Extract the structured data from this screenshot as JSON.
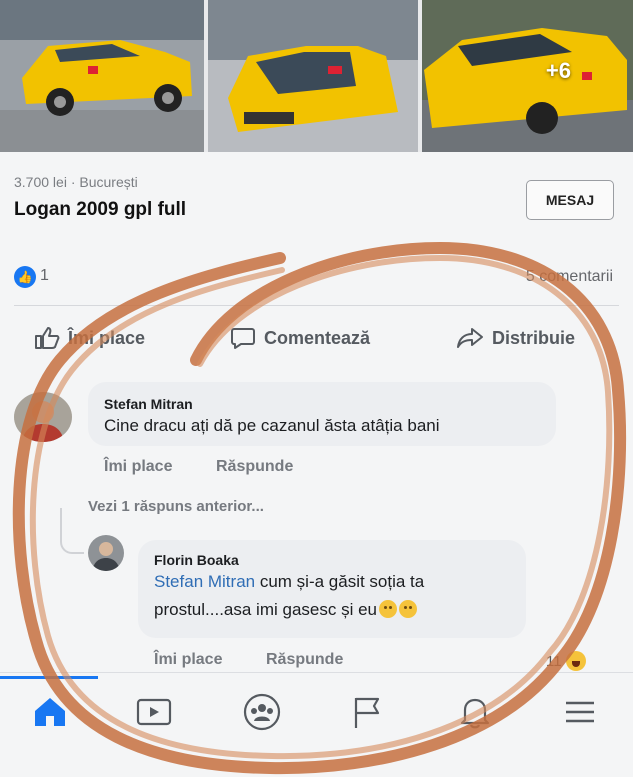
{
  "listing": {
    "photos_more": "+6",
    "price_location": "3.700 lei · București",
    "title": "Logan 2009 gpl full",
    "message_button": "MESAJ"
  },
  "stats": {
    "likes": "1",
    "comments": "5 comentarii"
  },
  "actions": {
    "like": "Îmi place",
    "comment": "Comentează",
    "share": "Distribuie"
  },
  "comments": [
    {
      "author": "Stefan Mitran",
      "text": "Cine dracu ați dă pe cazanul ăsta atâția bani",
      "like_label": "Îmi place",
      "reply_label": "Răspunde"
    },
    {
      "author": "Florin Boaka",
      "mention": "Stefan Mitran",
      "text": " cum și-a găsit soția ta prostul....asa imi gasesc și eu",
      "emoji": [
        "sweat-smile",
        "sweat-smile"
      ],
      "like_label": "Îmi place",
      "reply_label": "Răspunde",
      "reactions": "11"
    }
  ],
  "view_previous": "Vezi 1 răspuns anterior...",
  "tabs": [
    "home-icon",
    "video-icon",
    "groups-icon",
    "pages-icon",
    "notifications-icon",
    "menu-icon"
  ],
  "colors": {
    "accent": "#1877f2",
    "taxi_yellow": "#f2c200",
    "overlay_circle": "#c6703f"
  }
}
